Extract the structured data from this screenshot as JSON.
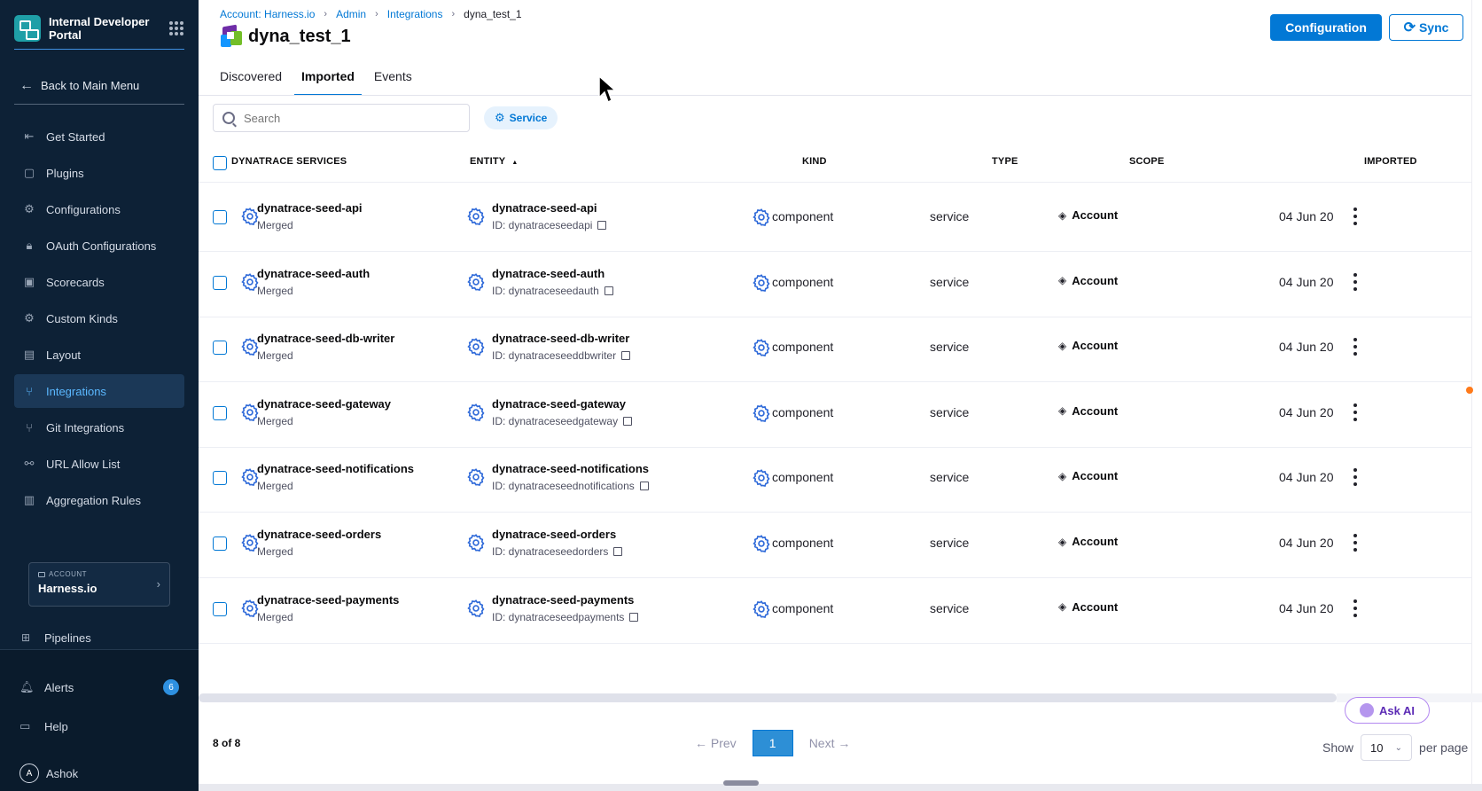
{
  "sidebar": {
    "brand_title": "Internal Developer Portal",
    "back_label": "Back to Main Menu",
    "items": [
      {
        "label": "Get Started",
        "icon": "get-started-icon"
      },
      {
        "label": "Plugins",
        "icon": "plugins-icon"
      },
      {
        "label": "Configurations",
        "icon": "configurations-icon"
      },
      {
        "label": "OAuth Configurations",
        "icon": "lock-icon"
      },
      {
        "label": "Scorecards",
        "icon": "scorecards-icon"
      },
      {
        "label": "Custom Kinds",
        "icon": "gear-icon"
      },
      {
        "label": "Layout",
        "icon": "layout-icon"
      },
      {
        "label": "Integrations",
        "icon": "integrations-icon",
        "active": true
      },
      {
        "label": "Git Integrations",
        "icon": "git-icon"
      },
      {
        "label": "URL Allow List",
        "icon": "link-icon"
      },
      {
        "label": "Aggregation Rules",
        "icon": "aggregation-icon"
      }
    ],
    "account_label": "ACCOUNT",
    "account_value": "Harness.io",
    "pipelines_label": "Pipelines",
    "alerts_label": "Alerts",
    "alerts_count": "6",
    "help_label": "Help",
    "user_initial": "A",
    "user_name": "Ashok"
  },
  "breadcrumb": {
    "account": "Account: Harness.io",
    "admin": "Admin",
    "integrations": "Integrations",
    "current": "dyna_test_1"
  },
  "page_title": "dyna_test_1",
  "buttons": {
    "configuration": "Configuration",
    "sync": "Sync"
  },
  "tabs": [
    {
      "label": "Discovered",
      "active": false
    },
    {
      "label": "Imported",
      "active": true
    },
    {
      "label": "Events",
      "active": false
    }
  ],
  "search": {
    "placeholder": "Search",
    "value": ""
  },
  "filter_chip": "Service",
  "table": {
    "headers": {
      "services": "DYNATRACE SERVICES",
      "entity": "ENTITY",
      "entity_sort": "▲",
      "kind": "KIND",
      "type": "TYPE",
      "scope": "SCOPE",
      "imported": "IMPORTED"
    },
    "rows": [
      {
        "name": "dynatrace-seed-api",
        "status": "Merged",
        "entity": "dynatrace-seed-api",
        "entity_id": "ID: dynatraceseedapi",
        "kind": "component",
        "type": "service",
        "scope": "Account",
        "imported": "04 Jun 20"
      },
      {
        "name": "dynatrace-seed-auth",
        "status": "Merged",
        "entity": "dynatrace-seed-auth",
        "entity_id": "ID: dynatraceseedauth",
        "kind": "component",
        "type": "service",
        "scope": "Account",
        "imported": "04 Jun 20"
      },
      {
        "name": "dynatrace-seed-db-writer",
        "status": "Merged",
        "entity": "dynatrace-seed-db-writer",
        "entity_id": "ID: dynatraceseeddbwriter",
        "kind": "component",
        "type": "service",
        "scope": "Account",
        "imported": "04 Jun 20"
      },
      {
        "name": "dynatrace-seed-gateway",
        "status": "Merged",
        "entity": "dynatrace-seed-gateway",
        "entity_id": "ID: dynatraceseedgateway",
        "kind": "component",
        "type": "service",
        "scope": "Account",
        "imported": "04 Jun 20"
      },
      {
        "name": "dynatrace-seed-notifications",
        "status": "Merged",
        "entity": "dynatrace-seed-notifications",
        "entity_id": "ID: dynatraceseednotifications",
        "kind": "component",
        "type": "service",
        "scope": "Account",
        "imported": "04 Jun 20"
      },
      {
        "name": "dynatrace-seed-orders",
        "status": "Merged",
        "entity": "dynatrace-seed-orders",
        "entity_id": "ID: dynatraceseedorders",
        "kind": "component",
        "type": "service",
        "scope": "Account",
        "imported": "04 Jun 20"
      },
      {
        "name": "dynatrace-seed-payments",
        "status": "Merged",
        "entity": "dynatrace-seed-payments",
        "entity_id": "ID: dynatraceseedpayments",
        "kind": "component",
        "type": "service",
        "scope": "Account",
        "imported": "04 Jun 20"
      }
    ]
  },
  "ask_ai": "Ask AI",
  "pagination": {
    "count": "8 of 8",
    "prev": "← Prev",
    "page": "1",
    "next": "Next →",
    "show_label": "Show",
    "page_size": "10",
    "per_page": "per page"
  },
  "colors": {
    "accent": "#0278d5",
    "sidebar_bg": "#0d2136",
    "active_nav": "#5bb8ff"
  }
}
